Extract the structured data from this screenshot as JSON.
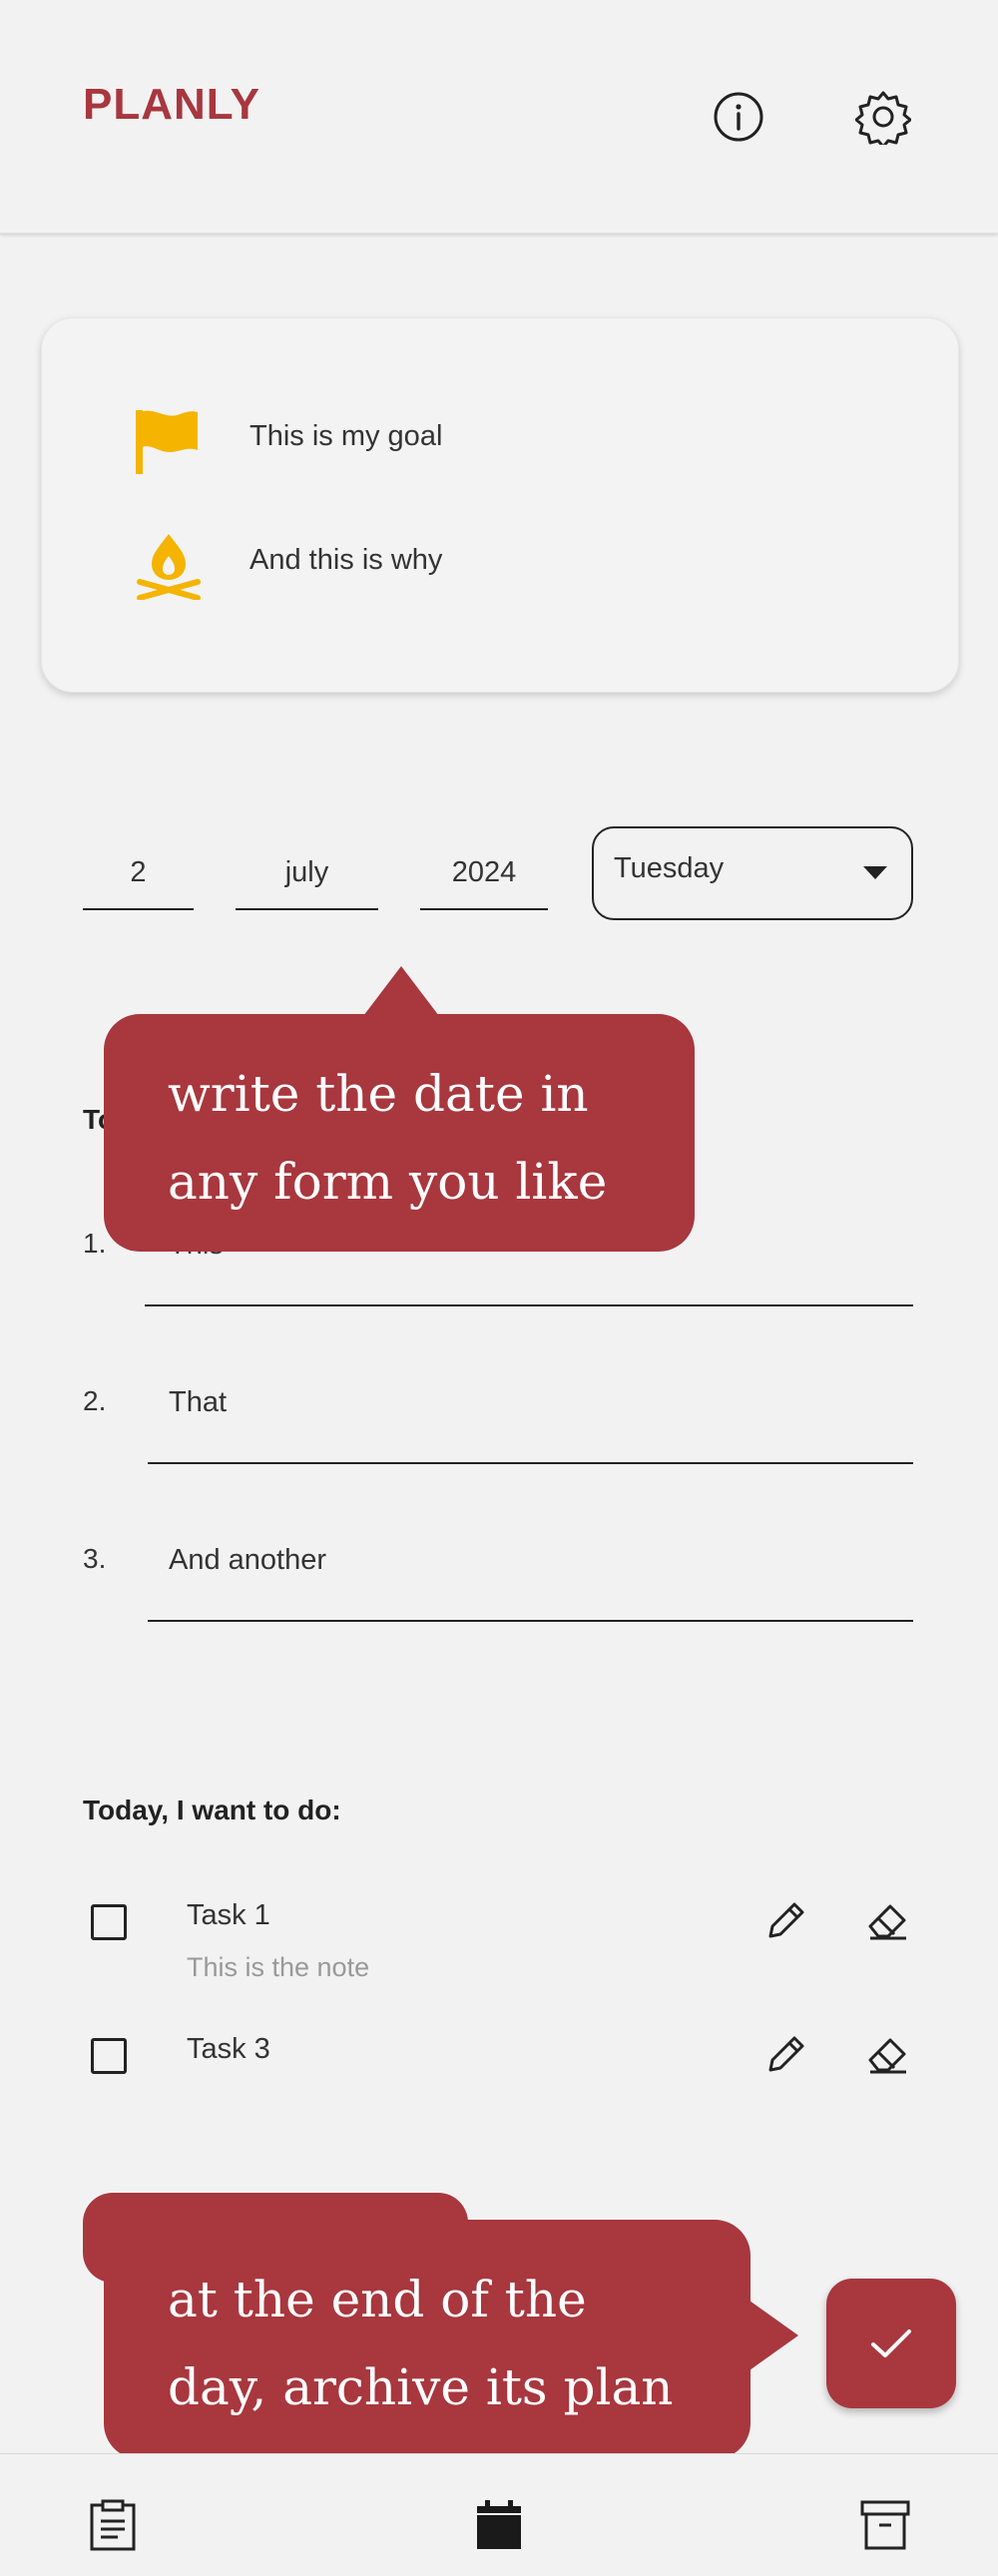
{
  "app": {
    "title": "PLANLY"
  },
  "toolbar": {
    "info_icon": "info-icon",
    "settings_icon": "gear-icon"
  },
  "goal_card": {
    "goal_text": "This is my goal",
    "why_text": "And this is why",
    "goal_icon": "flag-icon",
    "why_icon": "campfire-icon",
    "icon_color": "#f4b400"
  },
  "date": {
    "day": "2",
    "month": "july",
    "year": "2024",
    "weekday": "Tuesday"
  },
  "top_three": {
    "title": "To",
    "items": [
      {
        "number": "1.",
        "value": "This"
      },
      {
        "number": "2.",
        "value": "That"
      },
      {
        "number": "3.",
        "value": "And another"
      }
    ]
  },
  "tasks": {
    "title": "Today, I want to do:",
    "items": [
      {
        "title": "Task 1",
        "note": "This is the note"
      },
      {
        "title": "Task 3",
        "note": ""
      }
    ]
  },
  "tooltips": {
    "date_line1": "write the date in",
    "date_line2": "any form you like",
    "archive_line1": "at the end of the",
    "archive_line2": "day, archive its plan"
  },
  "bottom_nav": {
    "left": "clipboard-icon",
    "center": "calendar-icon",
    "right": "archive-icon"
  },
  "colors": {
    "brand": "#a8373e",
    "accent": "#f4b400",
    "background": "#f2f2f2"
  }
}
